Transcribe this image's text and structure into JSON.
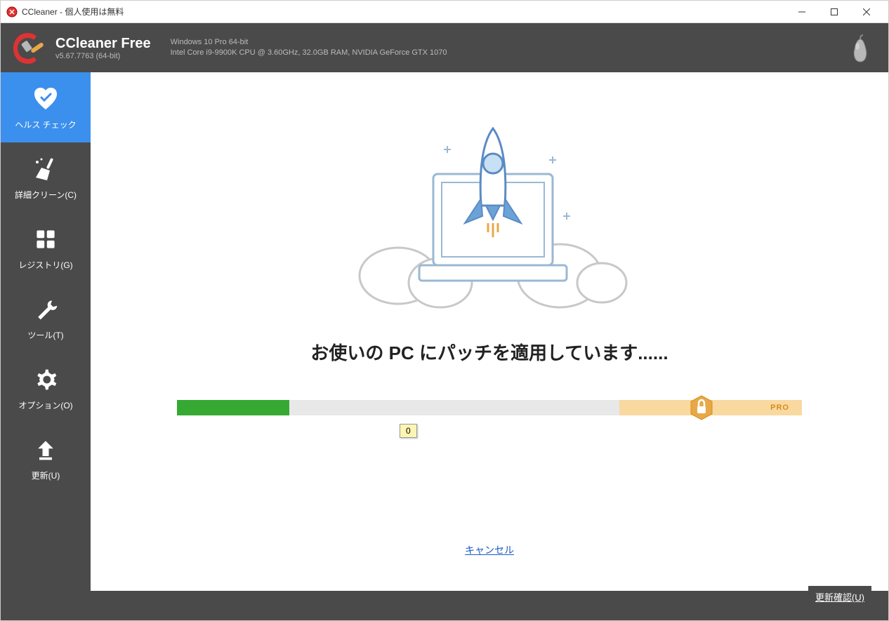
{
  "window": {
    "title": "CCleaner - 個人使用は無料"
  },
  "header": {
    "product_name": "CCleaner Free",
    "version": "v5.67.7763 (64-bit)",
    "sys_line1": "Windows 10 Pro 64-bit",
    "sys_line2": "Intel Core i9-9900K CPU @ 3.60GHz, 32.0GB RAM, NVIDIA GeForce GTX 1070"
  },
  "sidebar": {
    "items": [
      {
        "label": "ヘルス チェック"
      },
      {
        "label": "詳細クリーン(C)"
      },
      {
        "label": "レジストリ(G)"
      },
      {
        "label": "ツール(T)"
      },
      {
        "label": "オプション(O)"
      },
      {
        "label": "更新(U)"
      }
    ]
  },
  "main": {
    "headline": "お使いの PC にパッチを適用しています......",
    "progress_percent": 18,
    "progress_value": "0",
    "pro_label": "PRO",
    "cancel": "キャンセル",
    "update_check": "更新確認(U)"
  },
  "colors": {
    "accent": "#3b8fed",
    "green": "#36a933",
    "probar": "#f9d9a0"
  }
}
